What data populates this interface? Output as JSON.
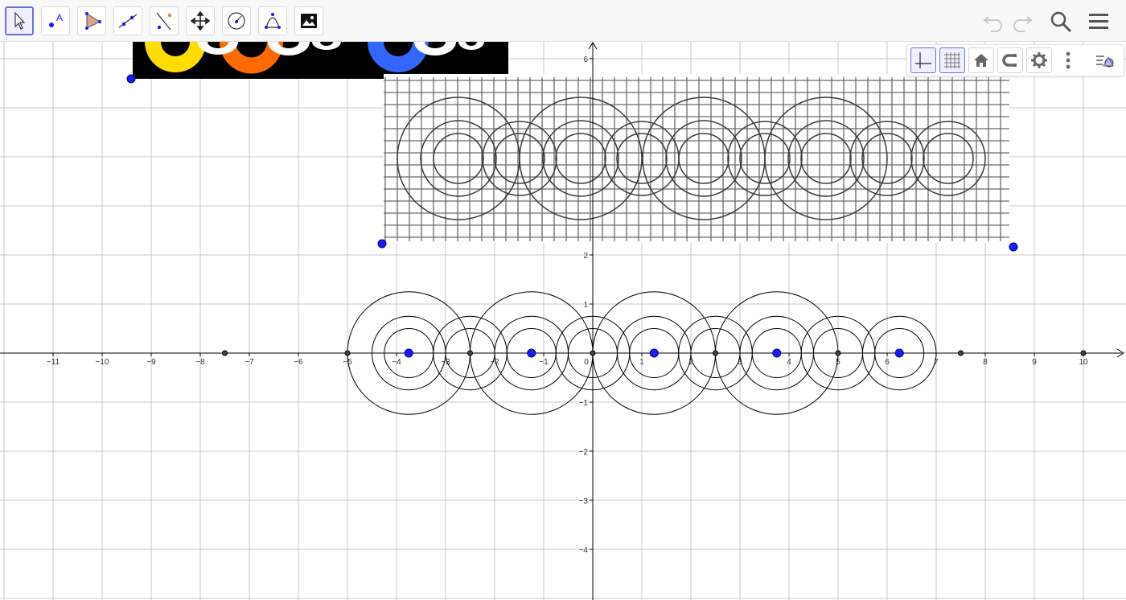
{
  "app": {
    "toolbar": {
      "tools": [
        {
          "name": "move-tool",
          "icon": "cursor-arrow-icon",
          "active": true
        },
        {
          "name": "point-tool",
          "icon": "point-with-label-icon"
        },
        {
          "name": "polygon-tool",
          "icon": "polygon-icon"
        },
        {
          "name": "line-tool",
          "icon": "line-through-points-icon"
        },
        {
          "name": "perpendicular-tool",
          "icon": "perpendicular-line-icon"
        },
        {
          "name": "move-view-tool",
          "icon": "move-graphics-view-icon"
        },
        {
          "name": "circle-tool",
          "icon": "circle-with-center-icon"
        },
        {
          "name": "conic-tool",
          "icon": "conic-icon"
        },
        {
          "name": "image-tool",
          "icon": "insert-image-icon"
        }
      ],
      "right": [
        "undo-icon",
        "redo-icon",
        "search-icon",
        "menu-icon"
      ]
    },
    "style_bar": [
      "axes-toggle-icon",
      "grid-toggle-icon",
      "home-icon",
      "point-capturing-icon",
      "settings-icon",
      "more-options-icon",
      "algebra-view-toggle-icon"
    ]
  },
  "graph": {
    "x_ticks": [
      "−11",
      "−10",
      "−9",
      "−8",
      "−7",
      "−6",
      "−5",
      "−4",
      "−3",
      "−2",
      "−1",
      "0",
      "1",
      "2",
      "3",
      "4",
      "5",
      "6",
      "7",
      "8",
      "9",
      "10"
    ],
    "y_ticks": [
      "6",
      "2",
      "1",
      "−1",
      "−2",
      "−3",
      "−4"
    ],
    "colors": {
      "point": "#1a1aff",
      "axis": "#000000",
      "grid": "#c8c8c8",
      "yellow": "#ffdd00",
      "orange": "#ff6a00",
      "blue": "#3366ff"
    },
    "circle_groups": [
      {
        "center": [
          -3.75,
          0
        ],
        "radii": [
          1.25,
          0.75,
          0.5
        ]
      },
      {
        "center": [
          -1.25,
          0
        ],
        "radii": [
          1.25,
          0.75,
          0.5
        ]
      },
      {
        "center": [
          1.25,
          0
        ],
        "radii": [
          1.25,
          0.75,
          0.5
        ]
      },
      {
        "center": [
          3.75,
          0
        ],
        "radii": [
          1.25,
          0.75,
          0.5
        ]
      },
      {
        "center": [
          6.25,
          0
        ],
        "radii": [
          0.75,
          0.5
        ]
      },
      {
        "center": [
          -2.5,
          0
        ],
        "radii": [
          0.75,
          0.5
        ]
      },
      {
        "center": [
          0,
          0
        ],
        "radii": [
          0.75,
          0.5
        ]
      },
      {
        "center": [
          2.5,
          0
        ],
        "radii": [
          0.75,
          0.5
        ]
      },
      {
        "center": [
          5,
          0
        ],
        "radii": [
          0.75,
          0.5
        ]
      }
    ],
    "blue_points": [
      [
        -3.75,
        0
      ],
      [
        -1.25,
        0
      ],
      [
        1.25,
        0
      ],
      [
        3.75,
        0
      ],
      [
        6.25,
        0
      ]
    ],
    "dark_points": [
      -7.5,
      -5,
      -2.5,
      0,
      2.5,
      5,
      7.5,
      10
    ]
  }
}
